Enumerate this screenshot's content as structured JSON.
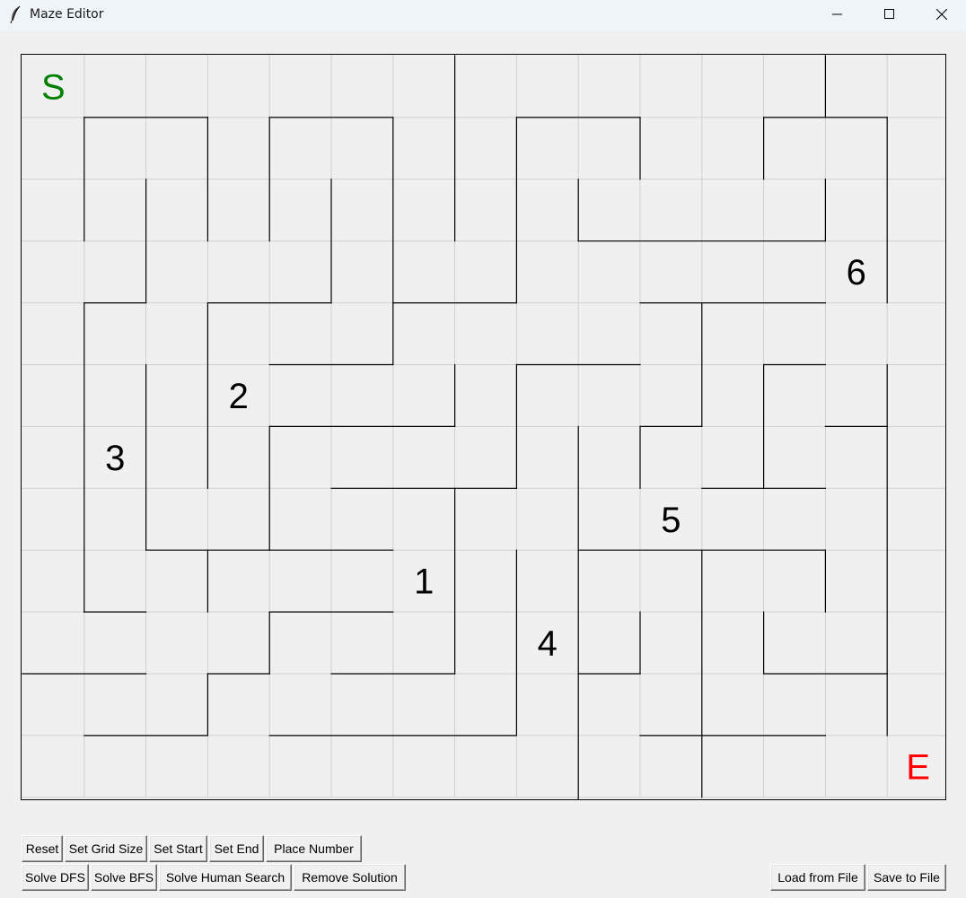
{
  "window": {
    "title": "Maze Editor",
    "icon": "feather-icon",
    "controls": [
      "minimize-icon",
      "maximize-icon",
      "close-icon"
    ]
  },
  "maze": {
    "rows": 12,
    "cols": 15,
    "start": {
      "row": 0,
      "col": 0,
      "label": "S",
      "color": "#008000"
    },
    "end": {
      "row": 11,
      "col": 14,
      "label": "E",
      "color": "#ff0000"
    },
    "numbers": [
      {
        "label": "1",
        "row": 8,
        "col": 6
      },
      {
        "label": "2",
        "row": 5,
        "col": 3
      },
      {
        "label": "3",
        "row": 6,
        "col": 1
      },
      {
        "label": "4",
        "row": 9,
        "col": 8
      },
      {
        "label": "5",
        "row": 7,
        "col": 10
      },
      {
        "label": "6",
        "row": 3,
        "col": 13
      }
    ],
    "walls": [
      [
        7,
        0,
        7,
        1
      ],
      [
        13,
        0,
        13,
        1
      ],
      [
        1,
        1,
        3,
        1
      ],
      [
        4,
        1,
        6,
        1
      ],
      [
        8,
        1,
        10,
        1
      ],
      [
        12,
        1,
        14,
        1
      ],
      [
        1,
        1,
        1,
        3
      ],
      [
        2,
        2,
        2,
        4
      ],
      [
        3,
        1,
        3,
        3
      ],
      [
        4,
        1,
        4,
        3
      ],
      [
        5,
        2,
        5,
        4
      ],
      [
        6,
        1,
        6,
        4
      ],
      [
        7,
        1,
        7,
        3
      ],
      [
        8,
        1,
        8,
        4
      ],
      [
        9,
        2,
        9,
        3
      ],
      [
        10,
        1,
        10,
        2
      ],
      [
        12,
        1,
        12,
        2
      ],
      [
        13,
        2,
        13,
        3
      ],
      [
        14,
        1,
        14,
        4
      ],
      [
        9,
        3,
        13,
        3
      ],
      [
        3,
        4,
        5,
        4
      ],
      [
        6,
        4,
        8,
        4
      ],
      [
        10,
        4,
        13,
        4
      ],
      [
        1,
        4,
        2,
        4
      ],
      [
        1,
        4,
        1,
        9
      ],
      [
        3,
        4,
        3,
        7
      ],
      [
        6,
        4,
        6,
        5
      ],
      [
        11,
        4,
        11,
        6
      ],
      [
        4,
        5,
        6,
        5
      ],
      [
        8,
        5,
        10,
        5
      ],
      [
        12,
        5,
        13,
        5
      ],
      [
        2,
        5,
        2,
        8
      ],
      [
        7,
        5,
        7,
        6
      ],
      [
        8,
        5,
        8,
        7
      ],
      [
        12,
        5,
        12,
        7
      ],
      [
        14,
        5,
        14,
        6
      ],
      [
        4,
        6,
        7,
        6
      ],
      [
        10,
        6,
        11,
        6
      ],
      [
        13,
        6,
        14,
        6
      ],
      [
        4,
        6,
        4,
        8
      ],
      [
        9,
        6,
        9,
        13
      ],
      [
        10,
        6,
        10,
        7
      ],
      [
        14,
        6,
        14,
        11
      ],
      [
        5,
        7,
        8,
        7
      ],
      [
        11,
        7,
        13,
        7
      ],
      [
        7,
        7,
        7,
        10
      ],
      [
        2,
        8,
        4,
        8
      ],
      [
        4,
        8,
        6,
        8
      ],
      [
        9,
        8,
        13,
        8
      ],
      [
        3,
        8,
        3,
        9
      ],
      [
        8,
        8,
        8,
        11
      ],
      [
        11,
        8,
        11,
        12
      ],
      [
        13,
        8,
        13,
        9
      ],
      [
        1,
        9,
        2,
        9
      ],
      [
        4,
        9,
        6,
        9
      ],
      [
        4,
        9,
        4,
        10
      ],
      [
        10,
        9,
        10,
        10
      ],
      [
        12,
        9,
        12,
        10
      ],
      [
        0,
        10,
        2,
        10
      ],
      [
        3,
        10,
        4,
        10
      ],
      [
        5,
        10,
        7,
        10
      ],
      [
        9,
        10,
        10,
        10
      ],
      [
        12,
        10,
        14,
        10
      ],
      [
        3,
        10,
        3,
        11
      ],
      [
        1,
        11,
        3,
        11
      ],
      [
        4,
        11,
        8,
        11
      ],
      [
        10,
        11,
        11,
        11
      ],
      [
        11,
        11,
        13,
        11
      ]
    ]
  },
  "toolbar_row1": [
    "Reset",
    "Set Grid Size",
    "Set Start",
    "Set End",
    "Place Number"
  ],
  "toolbar_row2": [
    "Solve DFS",
    "Solve BFS",
    "Solve Human Search",
    "Remove Solution"
  ],
  "file_buttons": [
    "Load from File",
    "Save to File"
  ]
}
